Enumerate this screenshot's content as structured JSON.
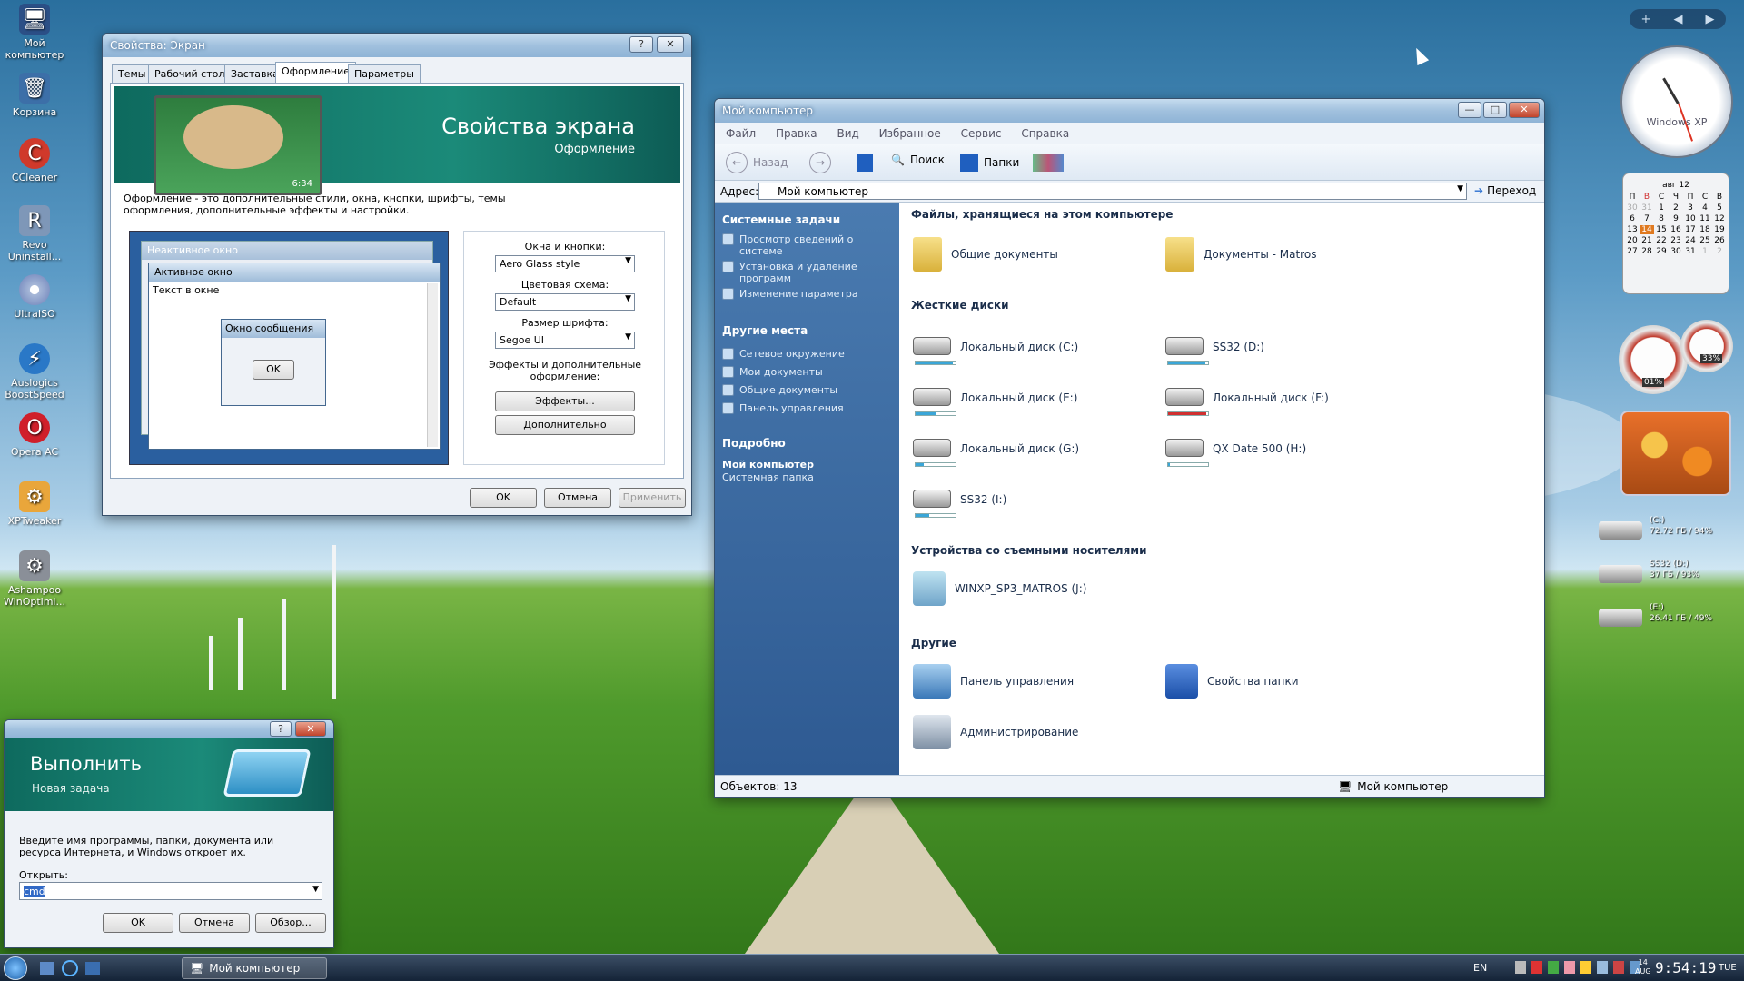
{
  "desktop": {
    "icons": [
      {
        "label": "Мой компьютер",
        "icon": "computer-icon"
      },
      {
        "label": "Корзина",
        "icon": "recycle-bin-icon"
      },
      {
        "label": "CCleaner",
        "icon": "ccleaner-icon"
      },
      {
        "label": "Revo Uninstall...",
        "icon": "revo-icon"
      },
      {
        "label": "UltraISO",
        "icon": "disc-icon"
      },
      {
        "label": "Auslogics BoostSpeed",
        "icon": "boostspeed-icon"
      },
      {
        "label": "Opera AC",
        "icon": "opera-icon"
      },
      {
        "label": "XPTweaker",
        "icon": "xptweaker-icon"
      },
      {
        "label": "Ashampoo WinOptimi...",
        "icon": "ashampoo-icon"
      }
    ]
  },
  "display_props": {
    "title": "Свойства: Экран",
    "tabs": [
      "Темы",
      "Рабочий стол",
      "Заставка",
      "Оформление",
      "Параметры"
    ],
    "active_tab": "Оформление",
    "banner_title": "Свойства экрана",
    "banner_subtitle": "Оформление",
    "preview_clock": "6:34",
    "description": "Оформление - это дополнительные стили, окна, кнопки, шрифты, темы оформления, дополнительные эффекты и настройки.",
    "preview": {
      "inactive_title": "Неактивное окно",
      "active_title": "Активное окно",
      "window_text": "Текст в окне",
      "msgbox_title": "Окно сообщения",
      "msgbox_ok": "OK"
    },
    "windows_buttons_label": "Окна и кнопки:",
    "windows_buttons_value": "Aero Glass style",
    "color_scheme_label": "Цветовая схема:",
    "color_scheme_value": "Default",
    "font_size_label": "Размер шрифта:",
    "font_size_value": "Segoe UI",
    "effects_label": "Эффекты и дополнительные оформление:",
    "effects_button": "Эффекты...",
    "advanced_button": "Дополнительно",
    "ok": "OK",
    "cancel": "Отмена",
    "apply": "Применить"
  },
  "my_computer": {
    "title": "Мой компьютер",
    "menu": [
      "Файл",
      "Правка",
      "Вид",
      "Избранное",
      "Сервис",
      "Справка"
    ],
    "toolbar": {
      "back": "Назад",
      "search": "Поиск",
      "folders": "Папки"
    },
    "address_label": "Адрес:",
    "address_value": "Мой компьютер",
    "go": "Переход",
    "sidebar": {
      "system_tasks_title": "Системные задачи",
      "system_tasks": [
        "Просмотр сведений о системе",
        "Установка и удаление программ",
        "Изменение параметра"
      ],
      "other_places_title": "Другие места",
      "other_places": [
        "Сетевое окружение",
        "Мои документы",
        "Общие документы",
        "Панель управления"
      ],
      "details_title": "Подробно",
      "details_name": "Мой компьютер",
      "details_type": "Системная папка"
    },
    "groups": {
      "stored_files": "Файлы, хранящиеся на этом компьютере",
      "hard_drives": "Жесткие диски",
      "removable": "Устройства со съемными носителями",
      "other": "Другие"
    },
    "stored_files": [
      "Общие документы",
      "Документы - Matros"
    ],
    "drives": [
      {
        "label": "Локальный диск (C:)",
        "fill": 0.94,
        "alert": false
      },
      {
        "label": "SS32 (D:)",
        "fill": 0.93,
        "alert": false
      },
      {
        "label": "Локальный диск (E:)",
        "fill": 0.49,
        "alert": false
      },
      {
        "label": "Локальный диск (F:)",
        "fill": 0.95,
        "alert": true
      },
      {
        "label": "Локальный диск (G:)",
        "fill": 0.2,
        "alert": false
      },
      {
        "label": "QX Date 500 (H:)",
        "fill": 0.05,
        "alert": false
      },
      {
        "label": "SS32 (I:)",
        "fill": 0.35,
        "alert": false
      }
    ],
    "removable_items": [
      "WINXP_SP3_MATROS (J:)"
    ],
    "other_items": [
      "Панель управления",
      "Свойства папки",
      "Администрирование"
    ],
    "status_count": "Объектов: 13",
    "status_location": "Мой компьютер"
  },
  "run_dialog": {
    "title_big": "Выполнить",
    "subtitle": "Новая задача",
    "description": "Введите имя программы, папки, документа или ресурса Интернета, и Windows откроет их.",
    "open_label": "Открыть:",
    "value": "cmd",
    "ok": "OK",
    "cancel": "Отмена",
    "browse": "Обзор..."
  },
  "taskbar": {
    "task": "Мой компьютер",
    "lang": "EN",
    "clock": "9:54:19",
    "day": "TUE",
    "date_day": "14",
    "date_month": "AUG"
  },
  "gadgets": {
    "clock_label": "Windows XP",
    "calendar_month": "авг 12",
    "calendar_days": [
      "П",
      "В",
      "С",
      "Ч",
      "П",
      "С",
      "В"
    ],
    "calendar_today": "14",
    "calendar_rows": [
      [
        "30",
        "31",
        "1",
        "2",
        "3",
        "4",
        "5"
      ],
      [
        "6",
        "7",
        "8",
        "9",
        "10",
        "11",
        "12"
      ],
      [
        "13",
        "14",
        "15",
        "16",
        "17",
        "18",
        "19"
      ],
      [
        "20",
        "21",
        "22",
        "23",
        "24",
        "25",
        "26"
      ],
      [
        "27",
        "28",
        "29",
        "30",
        "31",
        "1",
        "2"
      ]
    ],
    "cpu_label": "01%",
    "mem_label": "33%",
    "drives": [
      {
        "name": "(C:)",
        "info": "72.72 ГБ / 94%"
      },
      {
        "name": "SS32 (D:)",
        "info": "37 ГБ / 93%"
      },
      {
        "name": "(E:)",
        "info": "26.41 ГБ / 49%"
      }
    ]
  }
}
